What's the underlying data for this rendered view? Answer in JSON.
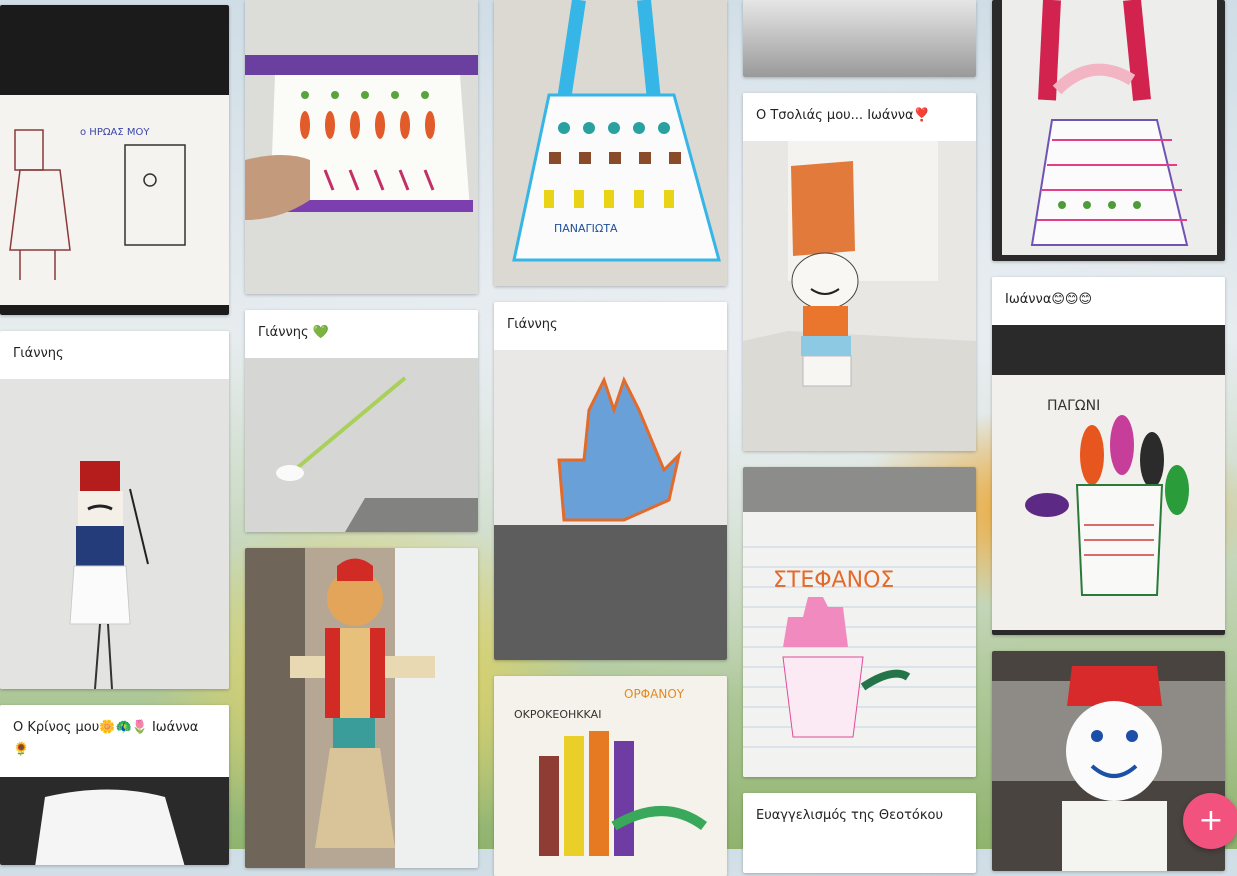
{
  "captions": {
    "giannis_1": "Γιάννης",
    "krinos": "Ο Κρίνος μου🌼🦚🌷 Ιωάννα 🌻",
    "giannis_heart": "Γιάννης 💚",
    "giannis_2": "Γιάννης",
    "tsolias": "Ο Τσολιάς μου... Ιωάννα❣️",
    "evangelismos": "Ευαγγελισμός της Θεοτόκου",
    "ioanna": "Ιωάννα😊😊😊"
  },
  "drawing_text": {
    "heroes": "ο ΗΡΩΑΣ ΜΟΥ",
    "panagiota": "ΠΑΝΑΓΙΩΤΑ",
    "stefanos": "ΣΤΕΦΑΝΟΣ",
    "pagoni": "ΠΑΓΩΝΙ",
    "orfanou": "ΟΡΦΑΝΟΥ",
    "okrokeo": "ΟΚΡΟΚΕΟΗΚΚΑΙ"
  },
  "fab": {
    "label": "+"
  }
}
